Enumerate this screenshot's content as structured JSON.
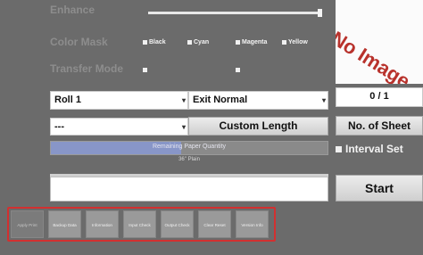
{
  "enhance": {
    "label": "Enhance"
  },
  "color_mask": {
    "label": "Color Mask",
    "options": [
      "Black",
      "Cyan",
      "Magenta",
      "Yellow"
    ]
  },
  "transfer_mode": {
    "label": "Transfer Mode"
  },
  "preview": {
    "text": "No Image"
  },
  "roll_select": {
    "value": "Roll 1"
  },
  "exit_select": {
    "value": "Exit Normal"
  },
  "sheet_counter": {
    "value": "0 / 1"
  },
  "length_select": {
    "value": "---"
  },
  "custom_length_button": {
    "label": "Custom Length"
  },
  "no_of_sheet_button": {
    "label": "No. of Sheet"
  },
  "paper_quantity": {
    "label": "Remaining Paper Quantity",
    "fraction": 0.47
  },
  "paper_size": {
    "text": "36\"  Plain"
  },
  "interval_set": {
    "label": "Interval Set",
    "checked": false
  },
  "start_button": {
    "label": "Start"
  },
  "bottom_tabs": [
    "Apply Print",
    "Backup Data",
    "Information",
    "Input Check",
    "Output Check",
    "Clear Reset",
    "Version Info"
  ],
  "colors": {
    "highlight_border": "#d23030",
    "progress_fill": "#8896c8",
    "no_image_text": "#b8322c"
  }
}
